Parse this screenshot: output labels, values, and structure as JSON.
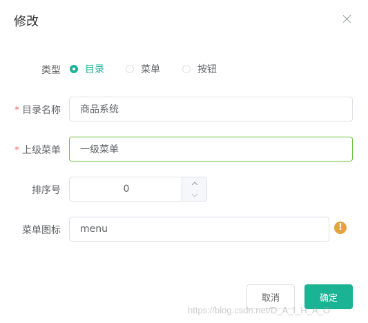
{
  "dialog": {
    "title": "修改",
    "close_icon": "close-icon"
  },
  "form": {
    "type": {
      "label": "类型",
      "options": [
        {
          "label": "目录",
          "checked": true
        },
        {
          "label": "菜单",
          "checked": false
        },
        {
          "label": "按钮",
          "checked": false
        }
      ]
    },
    "dir_name": {
      "required_mark": "*",
      "label": "目录名称",
      "value": "商品系统"
    },
    "parent_menu": {
      "required_mark": "*",
      "label": "上级菜单",
      "value": "一级菜单"
    },
    "order": {
      "label": "排序号",
      "value": "0"
    },
    "menu_icon": {
      "label": "菜单图标",
      "value": "menu",
      "warning_icon": "warning-icon",
      "warning_glyph": "!"
    }
  },
  "footer": {
    "cancel_label": "取消",
    "confirm_label": "确定"
  },
  "watermark": "https://blog.csdn.net/D_A_I_H_A_O",
  "colors": {
    "primary": "#1ab394",
    "required": "#f56c6c",
    "warning": "#e6a23c",
    "focus_border": "#67c23a"
  }
}
